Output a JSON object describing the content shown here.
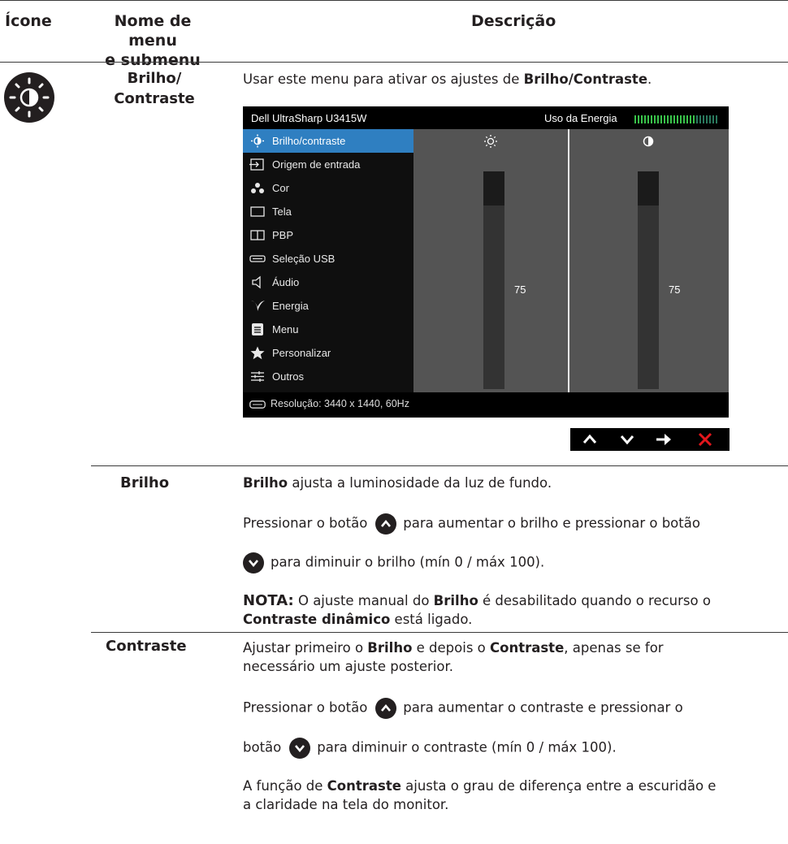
{
  "header": {
    "col_icon": "Ícone",
    "col_name_l1": "Nome de menu",
    "col_name_l2": "e submenu",
    "col_desc": "Descrição"
  },
  "section": {
    "title_l1": "Brilho/",
    "title_l2": "Contraste",
    "intro_pre": "Usar este menu para ativar os ajustes de ",
    "intro_bold": "Brilho/Contraste",
    "intro_post": "."
  },
  "osd": {
    "model": "Dell UltraSharp U3415W",
    "energy_label": "Uso da Energia",
    "menu": [
      {
        "label": "Brilho/contraste",
        "icon": "sun-half-icon",
        "selected": true
      },
      {
        "label": "Origem de entrada",
        "icon": "input-source-icon"
      },
      {
        "label": "Cor",
        "icon": "color-dots-icon"
      },
      {
        "label": "Tela",
        "icon": "display-icon"
      },
      {
        "label": "PBP",
        "icon": "pbp-icon"
      },
      {
        "label": "Seleção USB",
        "icon": "usb-icon"
      },
      {
        "label": "Áudio",
        "icon": "speaker-icon"
      },
      {
        "label": "Energia",
        "icon": "leaf-energy-icon"
      },
      {
        "label": "Menu",
        "icon": "menu-doc-icon"
      },
      {
        "label": "Personalizar",
        "icon": "star-icon"
      },
      {
        "label": "Outros",
        "icon": "sliders-icon"
      }
    ],
    "brightness_value": "75",
    "contrast_value": "75",
    "brightness_level": 75,
    "contrast_level": 75,
    "resolution": "Resolução: 3440 x 1440, 60Hz"
  },
  "brilho": {
    "term": "Brilho",
    "p1_bold": "Brilho",
    "p1_rest": " ajusta a luminosidade da luz de fundo.",
    "p2_a": "Pressionar o botão",
    "p2_b": "para aumentar o brilho e pressionar o botão",
    "p3": "para diminuir o brilho (mín 0 / máx 100).",
    "note_label": "NOTA:",
    "note_a": " O ajuste manual do ",
    "note_b": "Brilho",
    "note_c": " é desabilitado quando o recurso o",
    "note_d": "Contraste dinâmico",
    "note_e": " está ligado."
  },
  "contraste": {
    "term": "Contraste",
    "p1_a": "Ajustar primeiro o ",
    "p1_b": "Brilho",
    "p1_c": " e depois o ",
    "p1_d": "Contraste",
    "p1_e": ", apenas se for",
    "p1_f": "necessário um ajuste posterior.",
    "p2_a": "Pressionar o botão",
    "p2_b": "para aumentar o contraste e pressionar o",
    "p3_a": "botão",
    "p3_b": "para diminuir o contraste (mín 0 / máx 100).",
    "p4_a": "A função de ",
    "p4_b": "Contraste",
    "p4_c": " ajusta o grau de diferença entre a escuridão e",
    "p4_d": "a claridade na tela do monitor."
  }
}
